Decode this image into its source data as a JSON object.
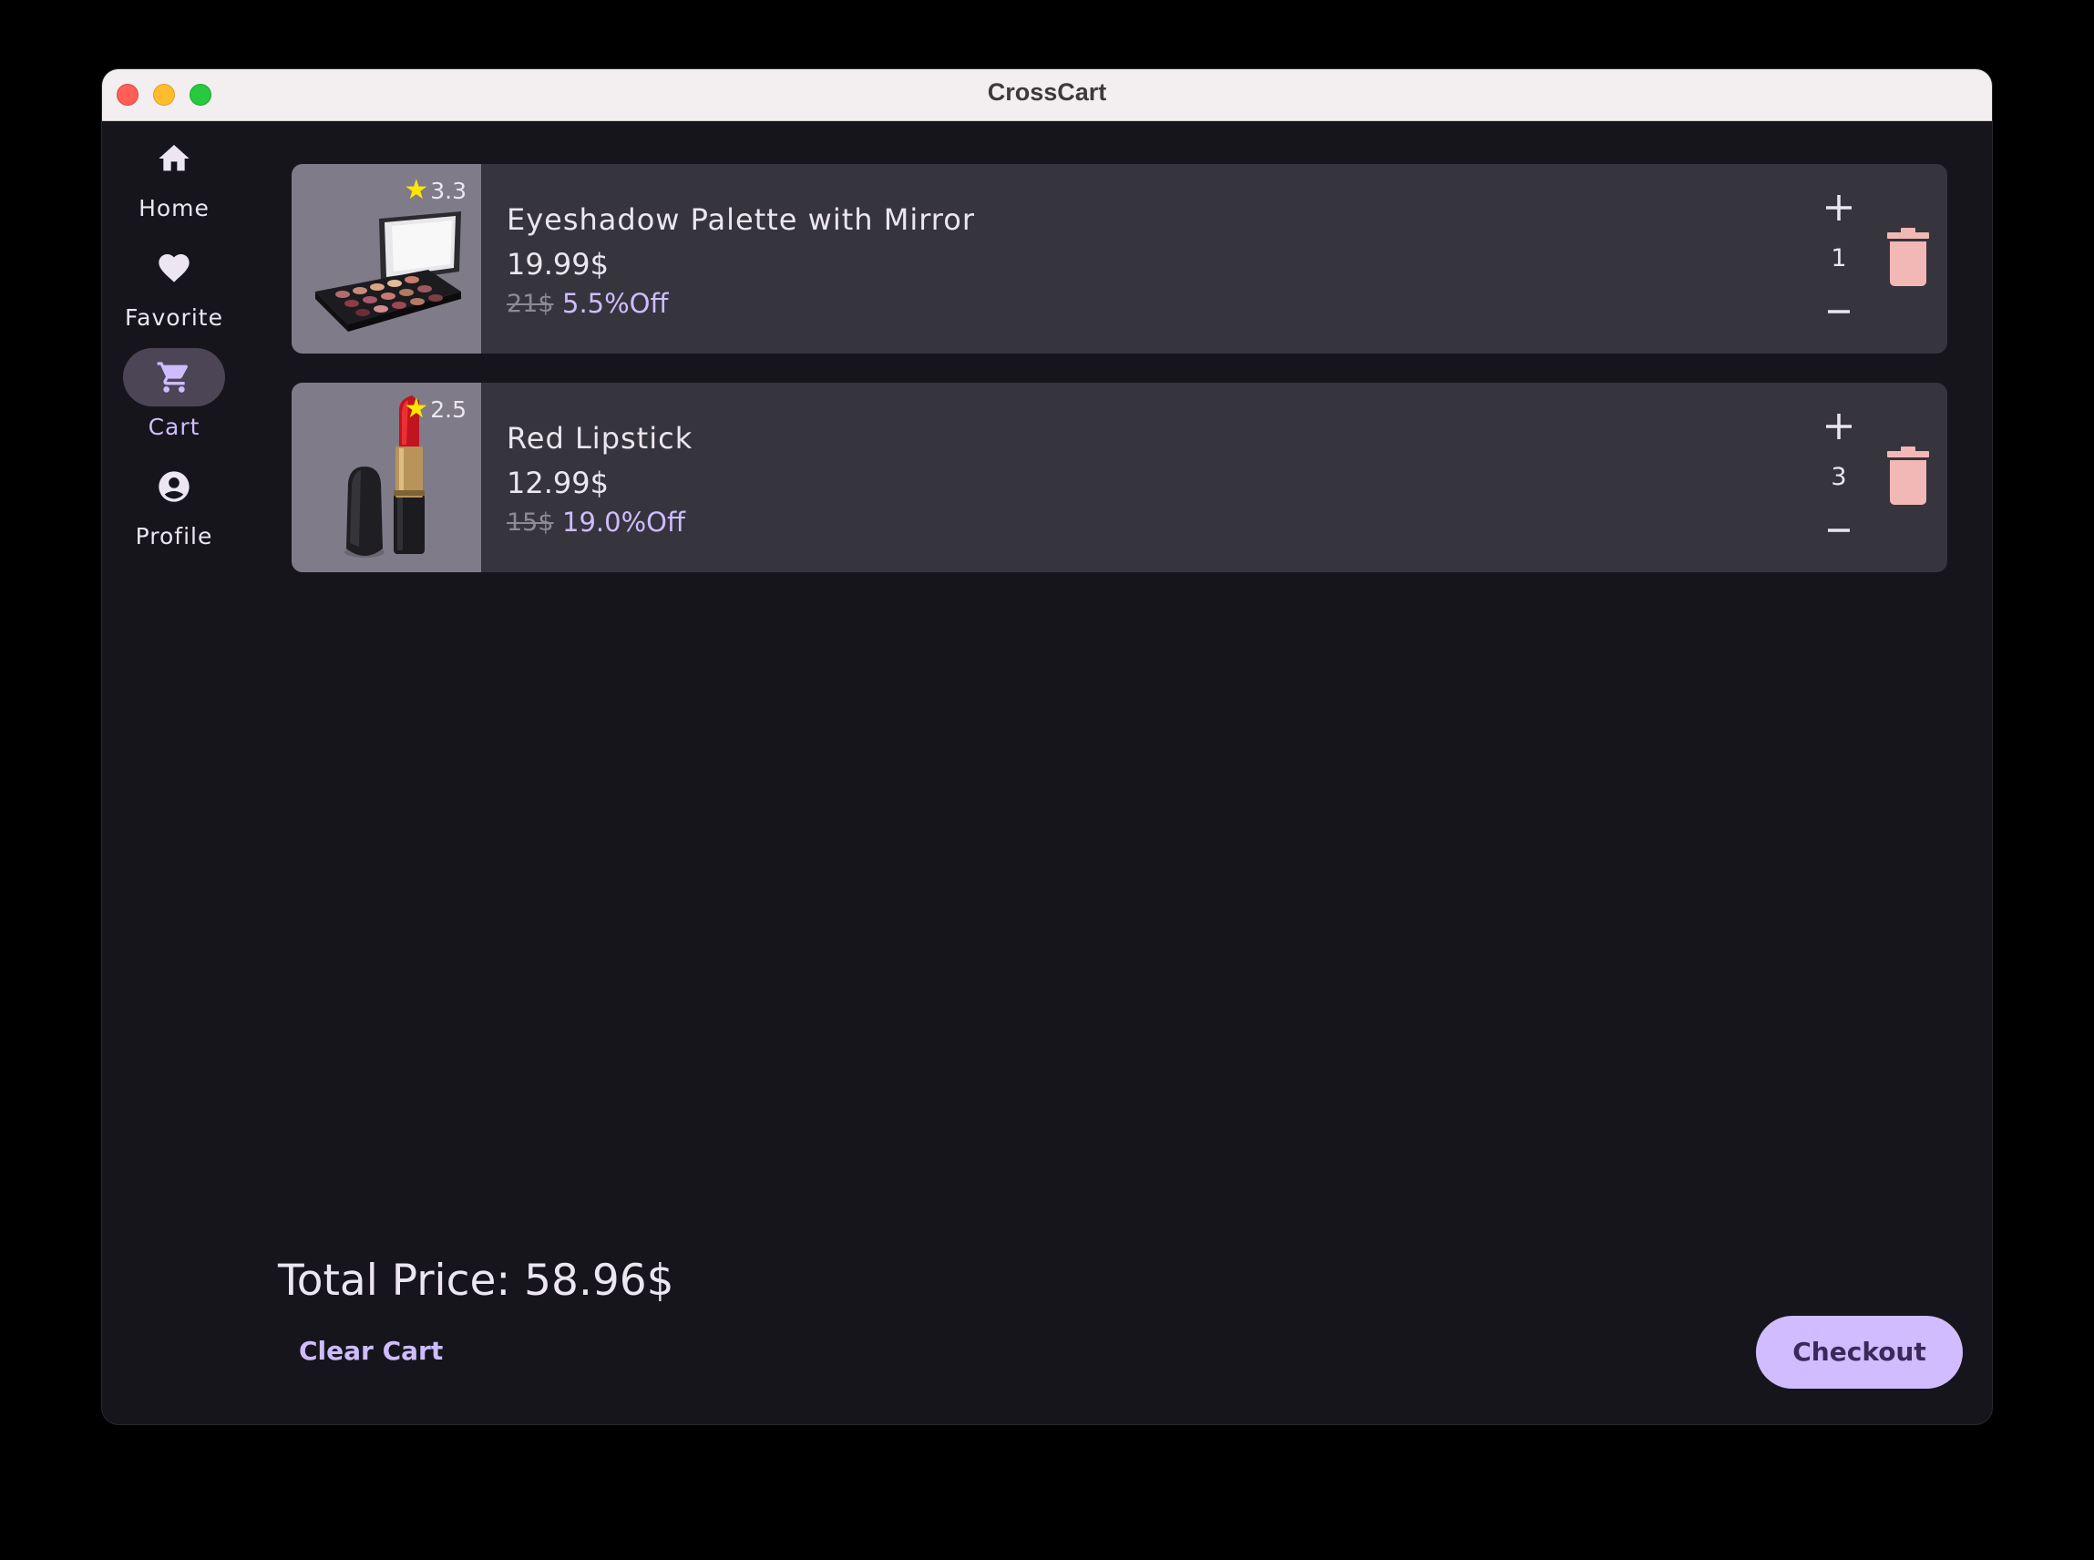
{
  "window": {
    "title": "CrossCart"
  },
  "sidebar": {
    "items": [
      {
        "label": "Home",
        "icon": "home-icon",
        "active": false
      },
      {
        "label": "Favorite",
        "icon": "heart-icon",
        "active": false
      },
      {
        "label": "Cart",
        "icon": "cart-icon",
        "active": true
      },
      {
        "label": "Profile",
        "icon": "account-circle-icon",
        "active": false
      }
    ]
  },
  "cart": {
    "items": [
      {
        "name": "Eyeshadow Palette with Mirror",
        "rating": "3.3",
        "price": "19.99$",
        "old_price": "21$",
        "discount": "5.5%Off",
        "quantity": "1",
        "image": "eyeshadow-palette-image"
      },
      {
        "name": "Red Lipstick",
        "rating": "2.5",
        "price": "12.99$",
        "old_price": "15$",
        "discount": "19.0%Off",
        "quantity": "3",
        "image": "red-lipstick-image"
      }
    ],
    "total": "Total Price: 58.96$",
    "clear_label": "Clear Cart",
    "checkout_label": "Checkout"
  },
  "colors": {
    "background": "#16151b",
    "card": "#36343d",
    "accent": "#cfbcff",
    "trash": "#f2b8b5",
    "star": "#ffe600"
  }
}
